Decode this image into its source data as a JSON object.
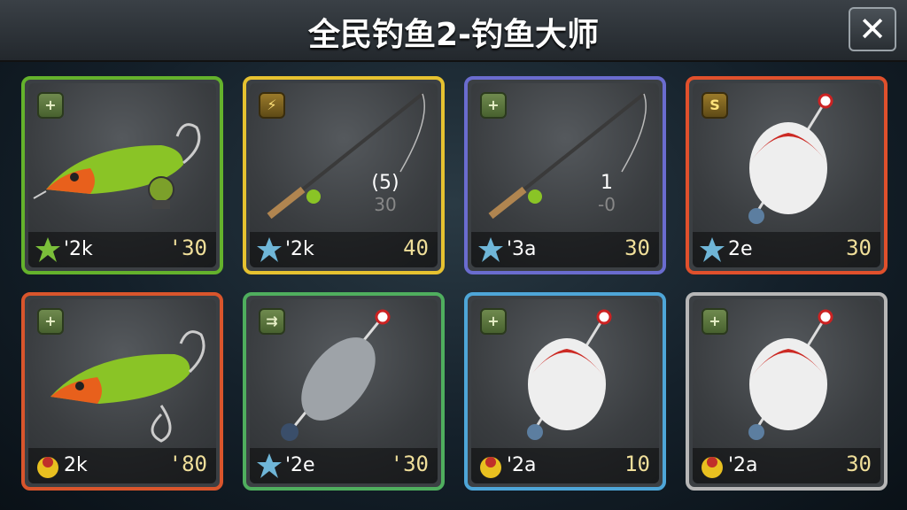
{
  "title": "全民钓鱼2-钓鱼大师",
  "close_label": "✕",
  "cards": [
    {
      "border": "#64b22c",
      "badge": "+",
      "code": "'2k",
      "price": "'30",
      "stat_top": "",
      "stat_bottom": ""
    },
    {
      "border": "#e6c230",
      "badge": "⚡",
      "code": "'2k",
      "price": "40",
      "stat_top": "(5)",
      "stat_bottom": "30"
    },
    {
      "border": "#6a6ccf",
      "badge": "+",
      "code": "'3a",
      "price": "30",
      "stat_top": "1",
      "stat_bottom": "-0"
    },
    {
      "border": "#e0502c",
      "badge": "S",
      "code": "2e",
      "price": "30",
      "stat_top": "",
      "stat_bottom": ""
    },
    {
      "border": "#d9552c",
      "badge": "+",
      "code": "2k",
      "price": "'80",
      "stat_top": "",
      "stat_bottom": ""
    },
    {
      "border": "#4fae5e",
      "badge": "⇉",
      "code": "'2e",
      "price": "'30",
      "stat_top": "",
      "stat_bottom": ""
    },
    {
      "border": "#4ea6d8",
      "badge": "+",
      "code": "'2a",
      "price": "10",
      "stat_top": "",
      "stat_bottom": ""
    },
    {
      "border": "#b7b7b7",
      "badge": "+",
      "code": "'2a",
      "price": "30",
      "stat_top": "",
      "stat_bottom": ""
    }
  ]
}
